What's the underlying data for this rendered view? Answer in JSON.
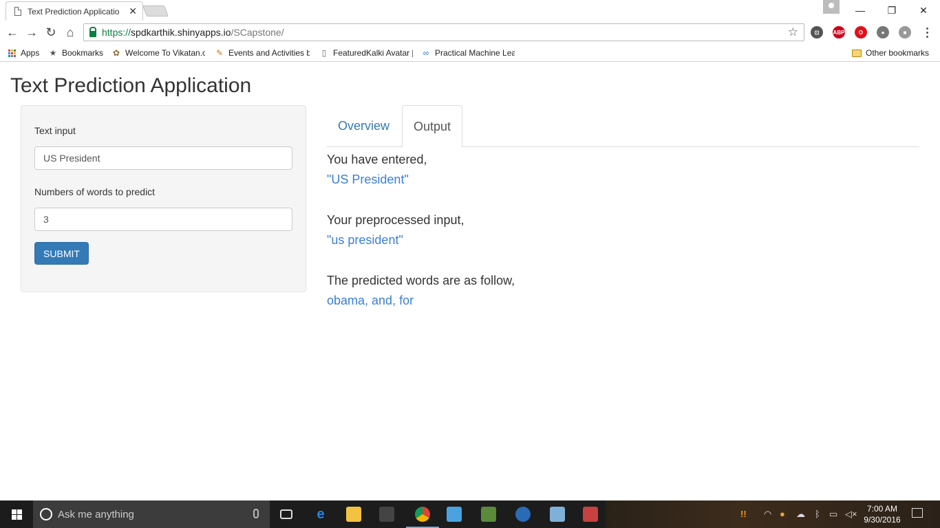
{
  "browser": {
    "tab_title": "Text Prediction Applicatio",
    "tab_close": "✕",
    "url_scheme": "https://",
    "url_host": "spdkarthik.shinyapps.io",
    "url_path": "/SCapstone/",
    "window_controls": {
      "minimize": "—",
      "restore": "❐",
      "close": "✕"
    },
    "nav": {
      "back": "←",
      "forward": "→",
      "reload": "↻",
      "home": "⌂",
      "star": "☆"
    },
    "extensions": [
      {
        "icon": "cast-icon",
        "label": "⊡",
        "color": "#555555"
      },
      {
        "icon": "adblock-plus-icon",
        "label": "ABP",
        "color": "#d0021b"
      },
      {
        "icon": "opera-icon",
        "label": "O",
        "color": "#e0101b"
      },
      {
        "icon": "globe-extension-icon",
        "label": "●",
        "color": "#777777"
      },
      {
        "icon": "extension-icon",
        "label": "■",
        "color": "#999999"
      }
    ],
    "bookmarks": [
      {
        "icon": "apps-grid-icon",
        "label": "Apps"
      },
      {
        "icon": "star-icon",
        "label": "Bookmarks"
      },
      {
        "icon": "vikatan-icon",
        "label": "Welcome To Vikatan.c"
      },
      {
        "icon": "events-icon",
        "label": "Events and Activities b"
      },
      {
        "icon": "page-icon",
        "label": "FeaturedKalki Avatar ["
      },
      {
        "icon": "coursera-icon",
        "label": "Practical Machine Lea"
      }
    ],
    "other_bookmarks": "Other bookmarks"
  },
  "page": {
    "title": "Text Prediction Application",
    "sidebar": {
      "text_input_label": "Text input",
      "text_input_value": "US President",
      "words_label": "Numbers of words to predict",
      "words_value": "3",
      "submit_label": "SUBMIT"
    },
    "tabs": [
      {
        "label": "Overview",
        "active": false
      },
      {
        "label": "Output",
        "active": true
      }
    ],
    "output": {
      "entered_label": "You have entered,",
      "entered_value": "\"US President\"",
      "preprocessed_label": "Your preprocessed input,",
      "preprocessed_value": "\"us president\"",
      "predicted_label": "The predicted words are as follow,",
      "predicted_value": "obama, and, for"
    }
  },
  "taskbar": {
    "search_placeholder": "Ask me anything",
    "apps": [
      {
        "icon": "task-view-icon",
        "color": "#1c1c1c"
      },
      {
        "icon": "edge-icon",
        "color": "#1e88e5"
      },
      {
        "icon": "file-explorer-icon",
        "color": "#f3c240"
      },
      {
        "icon": "store-icon",
        "color": "#444444"
      },
      {
        "icon": "chrome-icon",
        "color": "#db4437"
      },
      {
        "icon": "media-player-icon",
        "color": "#4aa3df"
      },
      {
        "icon": "hp-icon",
        "color": "#5a8a3a"
      },
      {
        "icon": "r-icon",
        "color": "#2a6bb8"
      },
      {
        "icon": "notes-icon",
        "color": "#7fb0d8"
      },
      {
        "icon": "snipping-tool-icon",
        "color": "#c84040"
      }
    ],
    "clock_time": "7:00 AM",
    "clock_date": "9/30/2016"
  }
}
